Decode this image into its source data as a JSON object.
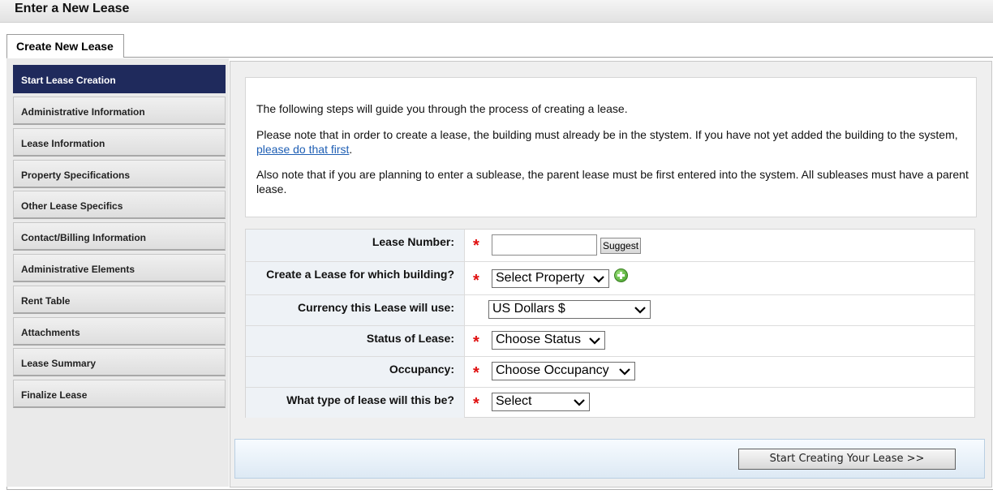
{
  "header": {
    "title": "Enter a New Lease"
  },
  "tab": {
    "label": "Create New Lease"
  },
  "sidebar": {
    "items": [
      {
        "label": "Start Lease Creation",
        "active": true
      },
      {
        "label": "Administrative Information"
      },
      {
        "label": "Lease Information"
      },
      {
        "label": "Property Specifications"
      },
      {
        "label": "Other Lease Specifics"
      },
      {
        "label": "Contact/Billing Information"
      },
      {
        "label": "Administrative Elements"
      },
      {
        "label": "Rent Table"
      },
      {
        "label": "Attachments"
      },
      {
        "label": "Lease Summary"
      },
      {
        "label": "Finalize Lease"
      }
    ]
  },
  "intro": {
    "p1": "The following steps will guide you through the process of creating a lease.",
    "p2_before": "Please note that in order to create a lease, the building must already be in the stystem. If you have not yet added the building to the system, ",
    "p2_link": "please do that first",
    "p2_after": ".",
    "p3": "Also note that if you are planning to enter a sublease, the parent lease must be first entered into the system. All subleases must have a parent lease."
  },
  "form": {
    "lease_number": {
      "label": "Lease Number:",
      "value": "",
      "suggest_label": "Suggest"
    },
    "building": {
      "label": "Create a Lease for which building?",
      "selected": "Select Property"
    },
    "currency": {
      "label": "Currency this Lease will use:",
      "selected": "US Dollars $"
    },
    "status": {
      "label": "Status of Lease:",
      "selected": "Choose Status"
    },
    "occupancy": {
      "label": "Occupancy:",
      "selected": "Choose Occupancy"
    },
    "lease_type": {
      "label": "What type of lease will this be?",
      "selected": "Select"
    },
    "required_marker": "*"
  },
  "footer": {
    "start_label": "Start Creating Your Lease >>"
  },
  "icons": {
    "chevron": "chevron-down-icon",
    "add": "add-property-icon"
  },
  "colors": {
    "active_nav": "#1f2a5c",
    "required": "#e01010",
    "link": "#1f5fb4"
  }
}
